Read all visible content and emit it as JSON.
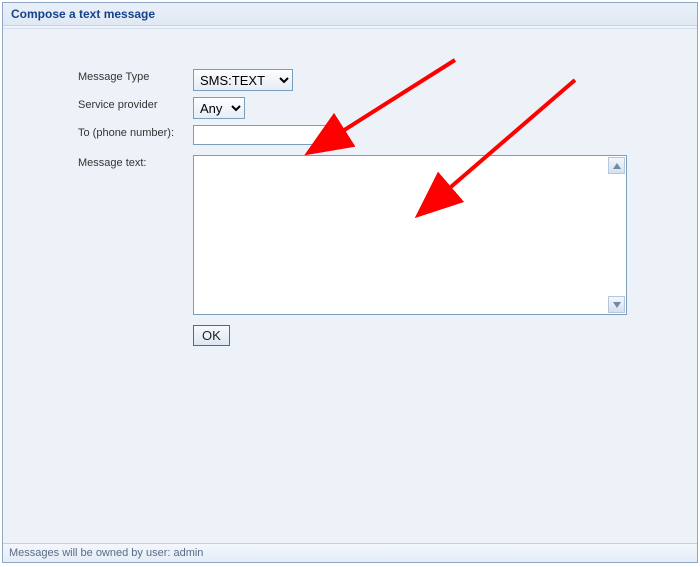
{
  "header": {
    "title": "Compose a text message"
  },
  "form": {
    "message_type": {
      "label": "Message Type",
      "value": "SMS:TEXT",
      "options": [
        "SMS:TEXT"
      ]
    },
    "service_provider": {
      "label": "Service provider",
      "value": "Any",
      "options": [
        "Any"
      ]
    },
    "to": {
      "label": "To (phone number):",
      "value": ""
    },
    "message_text": {
      "label": "Message text:",
      "value": ""
    },
    "ok_label": "OK"
  },
  "status": {
    "text": "Messages will be owned by user: admin"
  }
}
